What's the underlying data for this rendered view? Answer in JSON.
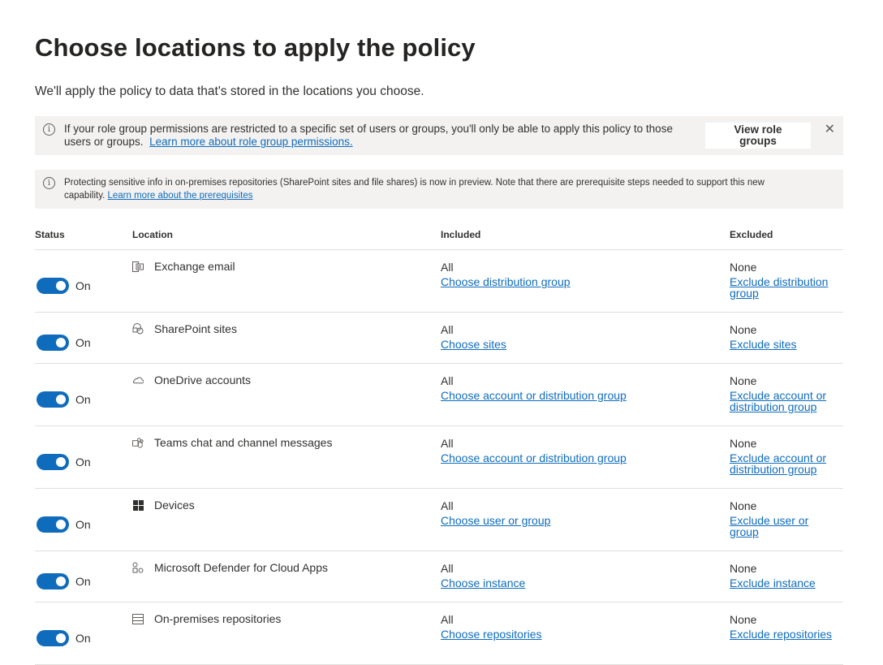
{
  "page": {
    "title": "Choose locations to apply the policy",
    "subtitle": "We'll apply the policy to data that's stored in the locations you choose."
  },
  "banner_role": {
    "text": "If your role group permissions are restricted to a specific set of users or groups, you'll only be able to apply this policy to those users or groups.",
    "link": "Learn more about role group permissions.",
    "button": "View role groups",
    "icon": "info-icon",
    "close_icon": "close-icon"
  },
  "banner_preview": {
    "text": "Protecting sensitive info in on-premises repositories (SharePoint sites and file shares) is now in preview. Note that there are prerequisite steps needed to support this new capability.",
    "link": "Learn more about the prerequisites",
    "icon": "info-icon"
  },
  "table": {
    "headers": {
      "status": "Status",
      "location": "Location",
      "included": "Included",
      "excluded": "Excluded"
    },
    "rows": [
      {
        "status": "On",
        "icon": "exchange-icon",
        "location": "Exchange email",
        "included": "All",
        "include_link": "Choose distribution group",
        "excluded": "None",
        "exclude_link": "Exclude distribution group"
      },
      {
        "status": "On",
        "icon": "sharepoint-icon",
        "location": "SharePoint sites",
        "included": "All",
        "include_link": "Choose sites",
        "excluded": "None",
        "exclude_link": "Exclude sites"
      },
      {
        "status": "On",
        "icon": "onedrive-icon",
        "location": "OneDrive accounts",
        "included": "All",
        "include_link": "Choose account or distribution group",
        "excluded": "None",
        "exclude_link": "Exclude account or distribution group"
      },
      {
        "status": "On",
        "icon": "teams-icon",
        "location": "Teams chat and channel messages",
        "included": "All",
        "include_link": "Choose account or distribution group",
        "excluded": "None",
        "exclude_link": "Exclude account or distribution group"
      },
      {
        "status": "On",
        "icon": "windows-icon",
        "location": "Devices",
        "included": "All",
        "include_link": "Choose user or group",
        "excluded": "None",
        "exclude_link": "Exclude user or group"
      },
      {
        "status": "On",
        "icon": "cloud-apps-icon",
        "location": "Microsoft Defender for Cloud Apps",
        "included": "All",
        "include_link": "Choose instance",
        "excluded": "None",
        "exclude_link": "Exclude instance"
      },
      {
        "status": "On",
        "icon": "repository-icon",
        "location": "On-premises repositories",
        "included": "All",
        "include_link": "Choose repositories",
        "excluded": "None",
        "exclude_link": "Exclude repositories"
      }
    ]
  },
  "colors": {
    "accent": "#0f6cbd",
    "banner_bg": "#f3f2f1",
    "text": "#323130"
  }
}
